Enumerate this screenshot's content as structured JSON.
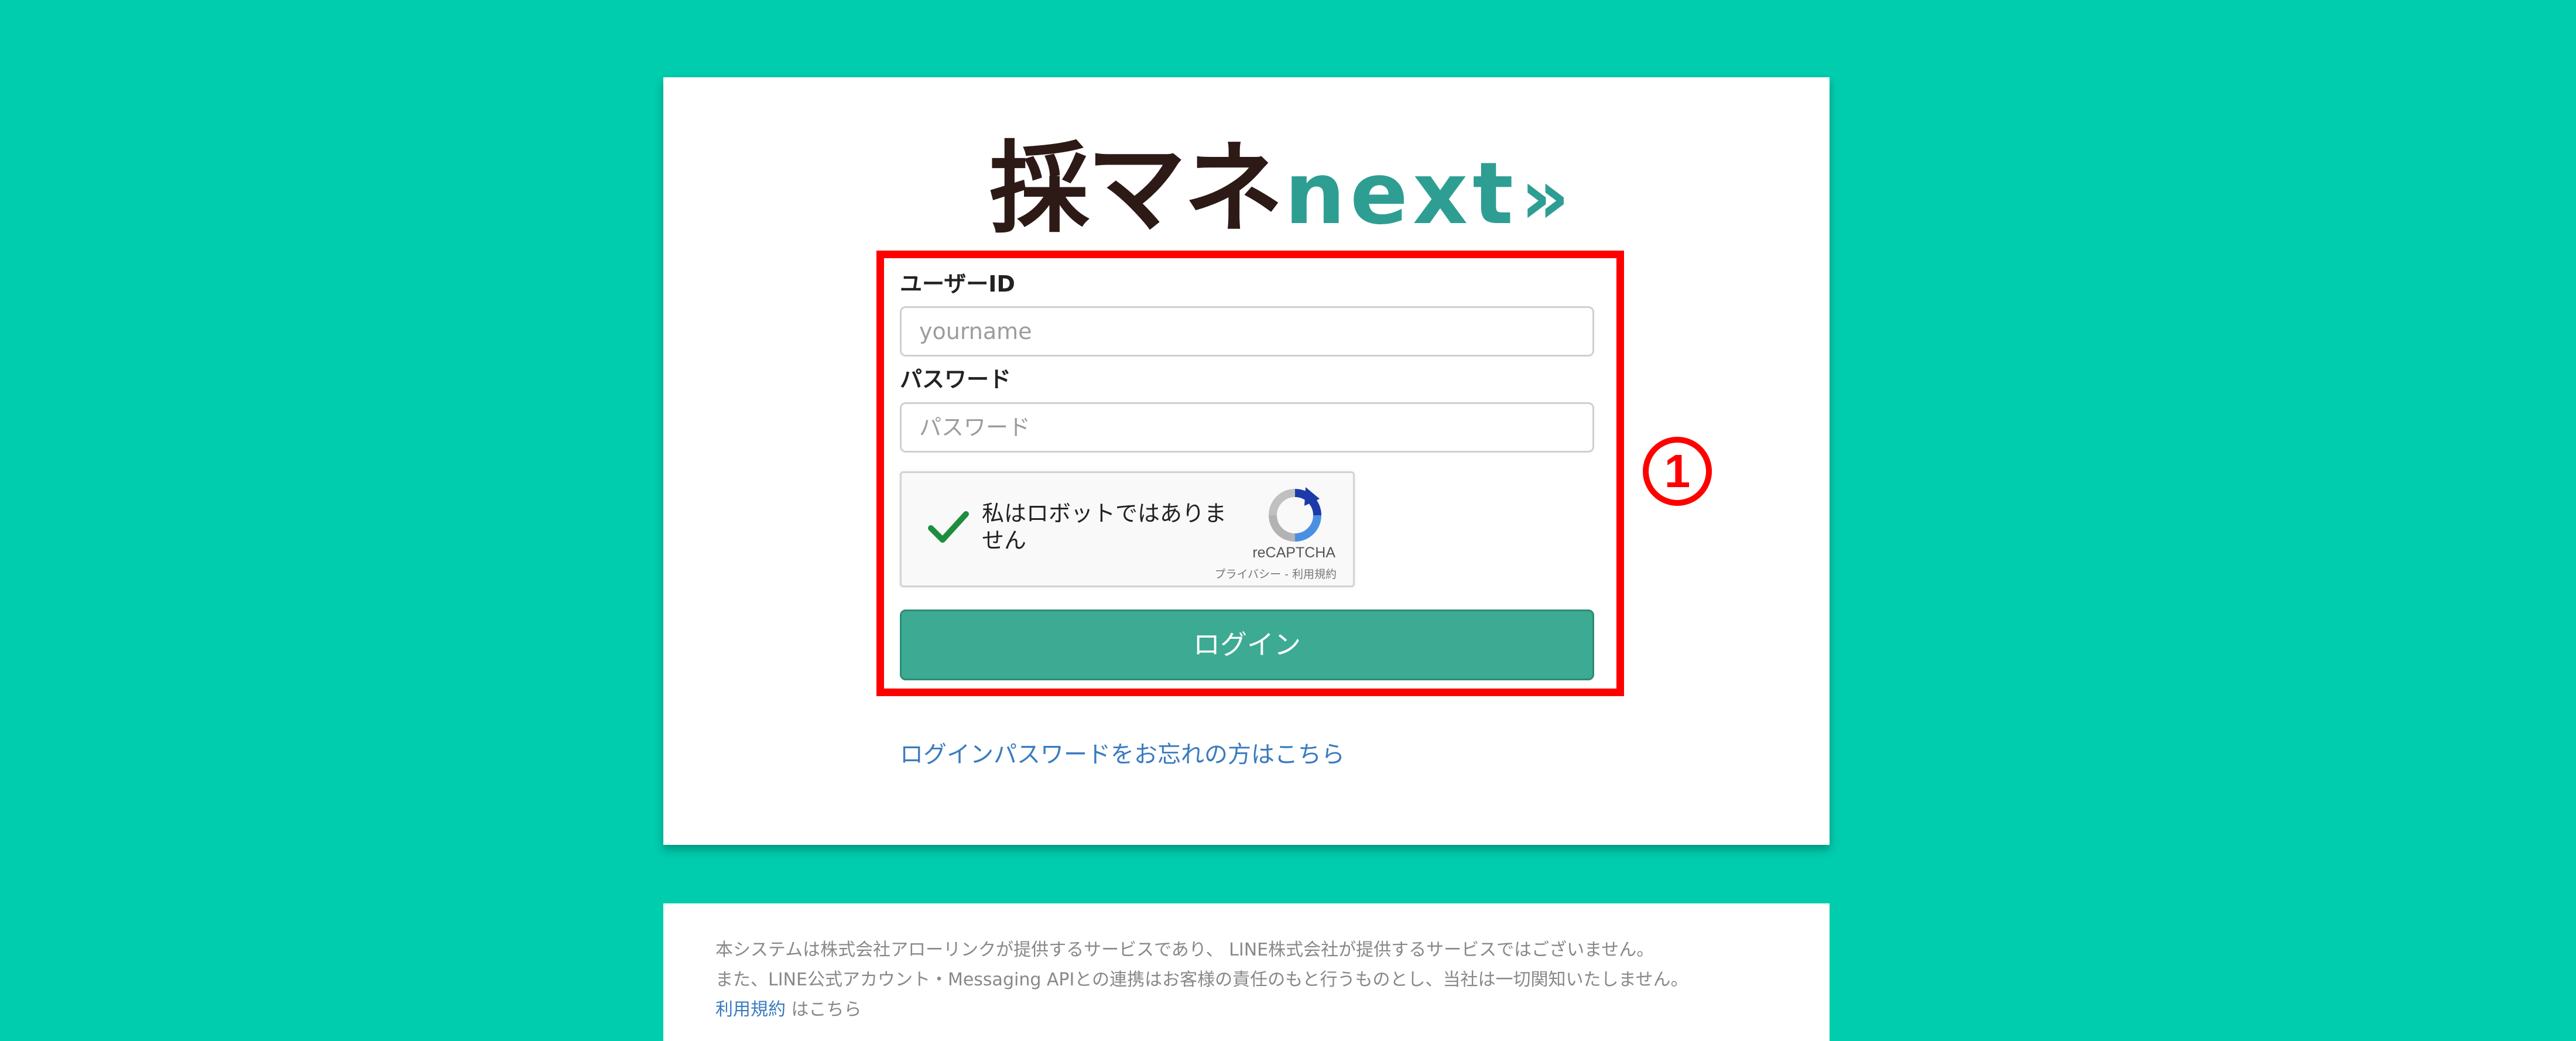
{
  "logo": {
    "jp": "採マネ",
    "en": "next",
    "arrows": "»"
  },
  "form": {
    "userid_label": "ユーザーID",
    "userid_placeholder": "yourname",
    "password_label": "パスワード",
    "password_placeholder": "パスワード",
    "recaptcha": {
      "text": "私はロボットではありません",
      "brand": "reCAPTCHA",
      "terms": "プライバシー - 利用規約"
    },
    "login_label": "ログイン",
    "forgot_link": "ログインパスワードをお忘れの方はこちら"
  },
  "annotation": {
    "number": "1"
  },
  "footer": {
    "line1": "本システムは株式会社アローリンクが提供するサービスであり、 LINE株式会社が提供するサービスではございません。",
    "line2": "また、LINE公式アカウント・Messaging APIとの連携はお客様の責任のもと行うものとし、当社は一切関知いたしません。",
    "terms_link": "利用規約",
    "terms_suffix": "はこちら"
  },
  "colors": {
    "background": "#00CCAE",
    "button": "#3DAA93",
    "link": "#3A7BBF",
    "highlight": "#FF0000",
    "logo_teal": "#2E9E93"
  }
}
